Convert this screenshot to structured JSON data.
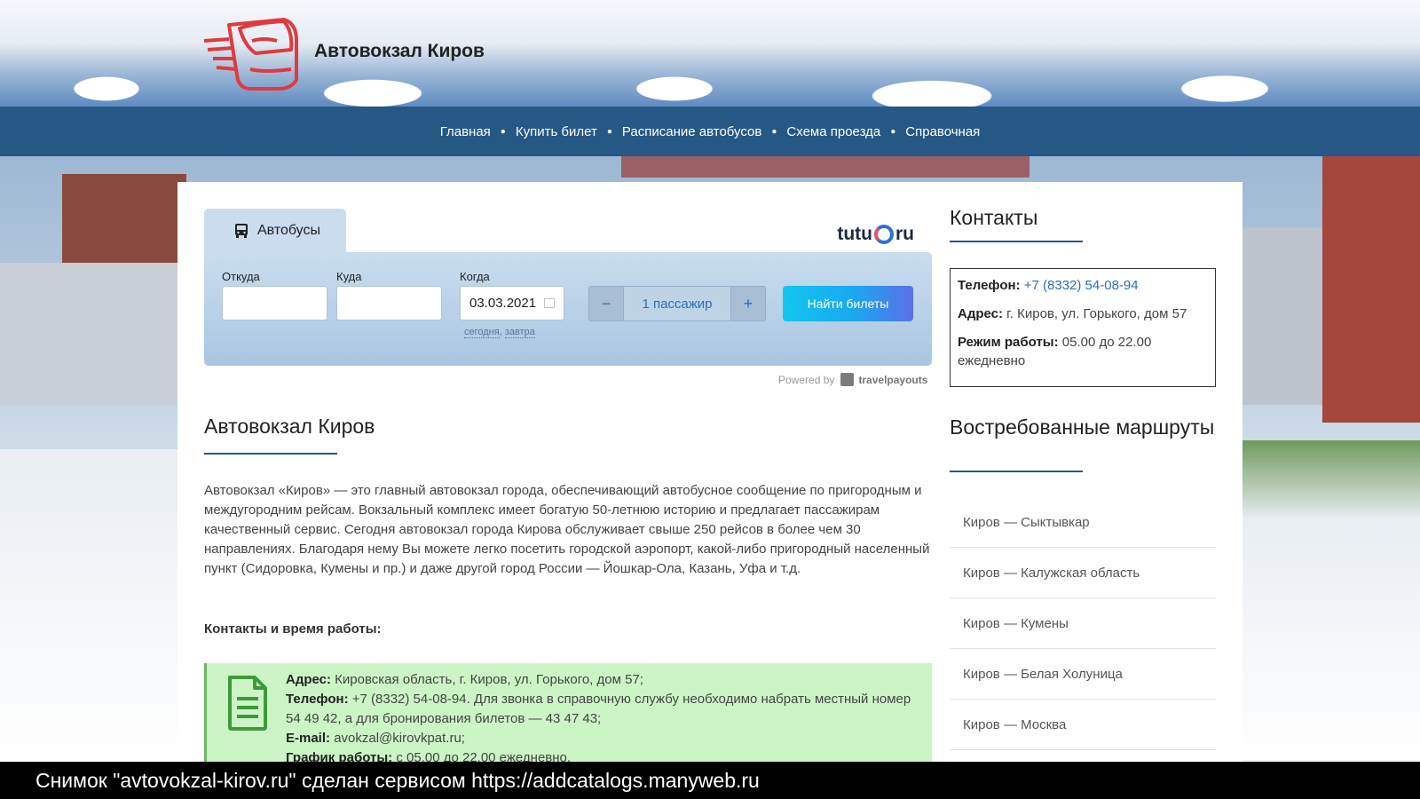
{
  "header": {
    "site_title": "Автовокзал Киров",
    "logo_color": "#e03a3e"
  },
  "nav": {
    "items": [
      "Главная",
      "Купить билет",
      "Расписание автобусов",
      "Схема проезда",
      "Справочная"
    ],
    "bg_color": "#255885"
  },
  "widget": {
    "tab_label": "Автобусы",
    "brand": {
      "left": "tutu",
      "right": "ru"
    },
    "from_label": "Откуда",
    "from_value": "",
    "to_label": "Куда",
    "to_value": "",
    "date_label": "Когда",
    "date_value": "03.03.2021",
    "date_link_today": "сегодня",
    "date_link_sep": ",",
    "date_link_tomorrow": "завтра",
    "pax_minus": "−",
    "pax_value": "1 пассажир",
    "pax_plus": "+",
    "find_button": "Найти билеты",
    "powered_by": "Powered by",
    "powered_brand": "travelpayouts"
  },
  "article": {
    "title": "Автовокзал Киров",
    "body": "Автовокзал «Киров» — это главный автовокзал города, обеспечивающий автобусное сообщение по пригородным и междугородним рейсам. Вокзальный комплекс имеет богатую 50-летнюю историю и предлагает пассажирам качественный сервис. Сегодня автовокзал города Кирова обслуживает свыше 250 рейсов в более чем 30 направлениях. Благодаря нему Вы можете легко посетить городской аэропорт, какой-либо пригородный населенный пункт (Сидоровка, Кумены и пр.) и даже другой город России — Йошкар-Ола, Казань, Уфа и т.д.",
    "contacts_heading": "Контакты и время работы:",
    "info": {
      "address_label": "Адрес:",
      "address_value": "Кировская область, г. Киров, ул. Горького, дом 57;",
      "phone_label": "Телефон:",
      "phone_value": "+7 (8332) 54-08-94. Для звонка в справочную службу необходимо набрать местный номер 54 49 42, а для бронирования билетов — 43 47 43;",
      "email_label": "E-mail:",
      "email_value": "avokzal@kirovkpat.ru;",
      "hours_label": "График работы:",
      "hours_value": "с 05.00 до 22.00 ежедневно."
    }
  },
  "sidebar": {
    "contacts_title": "Контакты",
    "phone_label": "Телефон:",
    "phone_value": "+7 (8332) 54-08-94",
    "address_label": "Адрес:",
    "address_value": "г. Киров, ул. Горького, дом 57",
    "hours_label": "Режим работы:",
    "hours_value": "05.00 до 22.00 ежедневно",
    "routes_title": "Востребованные маршруты",
    "routes": [
      "Киров — Сыктывкар",
      "Киров — Калужская область",
      "Киров — Кумены",
      "Киров — Белая Холуница",
      "Киров — Москва"
    ]
  },
  "caption": "Снимок \"avtovokzal-kirov.ru\" сделан сервисом https://addcatalogs.manyweb.ru"
}
